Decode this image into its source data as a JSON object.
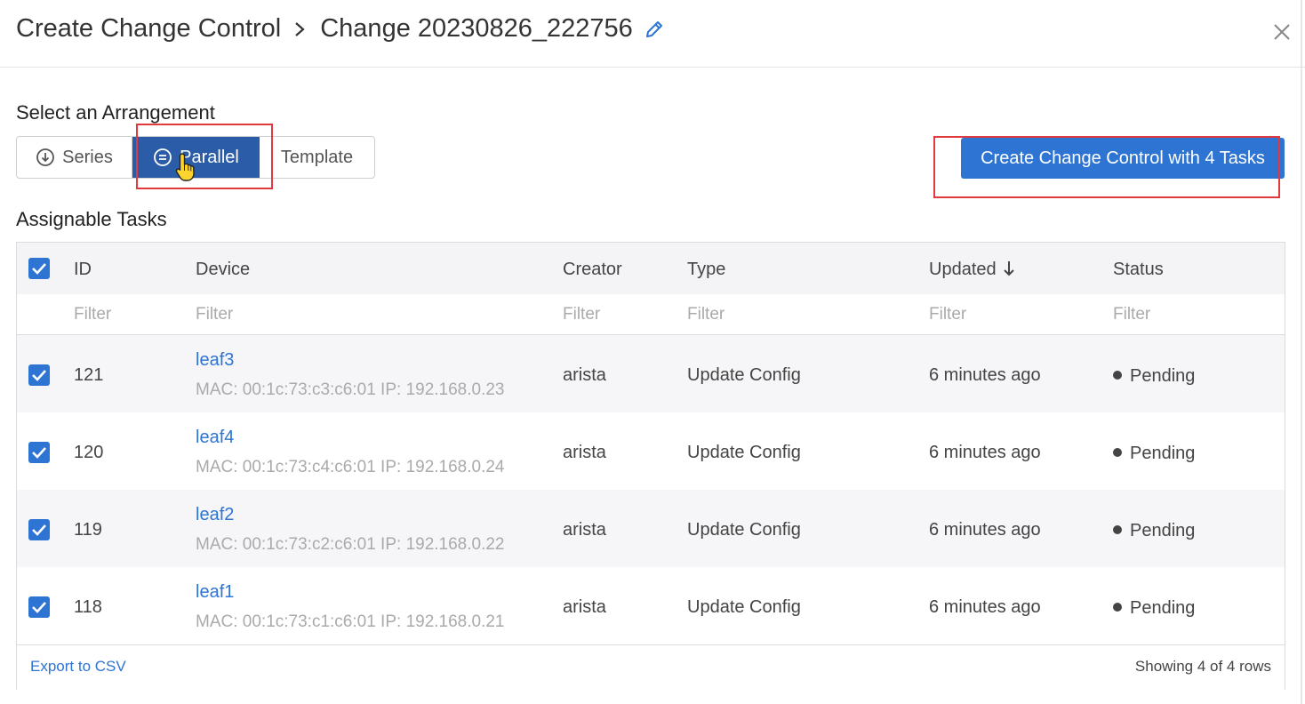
{
  "header": {
    "breadcrumb_parent": "Create Change Control",
    "breadcrumb_current": "Change 20230826_222756",
    "edit_icon": "pencil-icon",
    "close_icon": "close-icon"
  },
  "arrangement": {
    "title": "Select an Arrangement",
    "options": [
      {
        "label": "Series",
        "icon": "arrow-down-circle-icon",
        "selected": false
      },
      {
        "label": "Parallel",
        "icon": "equals-circle-icon",
        "selected": true
      },
      {
        "label": "Template",
        "selected": false
      }
    ]
  },
  "create_button": {
    "label": "Create Change Control with 4 Tasks"
  },
  "tasks": {
    "title": "Assignable Tasks",
    "columns": [
      "ID",
      "Device",
      "Creator",
      "Type",
      "Updated",
      "Status"
    ],
    "sort_column": "Updated",
    "sort_direction": "desc",
    "filter_placeholder": "Filter",
    "rows": [
      {
        "id": "121",
        "device": "leaf3",
        "device_detail": "MAC: 00:1c:73:c3:c6:01 IP: 192.168.0.23",
        "creator": "arista",
        "type": "Update Config",
        "updated": "6 minutes ago",
        "status": "Pending",
        "checked": true
      },
      {
        "id": "120",
        "device": "leaf4",
        "device_detail": "MAC: 00:1c:73:c4:c6:01 IP: 192.168.0.24",
        "creator": "arista",
        "type": "Update Config",
        "updated": "6 minutes ago",
        "status": "Pending",
        "checked": true
      },
      {
        "id": "119",
        "device": "leaf2",
        "device_detail": "MAC: 00:1c:73:c2:c6:01 IP: 192.168.0.22",
        "creator": "arista",
        "type": "Update Config",
        "updated": "6 minutes ago",
        "status": "Pending",
        "checked": true
      },
      {
        "id": "118",
        "device": "leaf1",
        "device_detail": "MAC: 00:1c:73:c1:c6:01 IP: 192.168.0.21",
        "creator": "arista",
        "type": "Update Config",
        "updated": "6 minutes ago",
        "status": "Pending",
        "checked": true
      }
    ],
    "export_label": "Export to CSV",
    "showing_label": "Showing 4 of 4 rows"
  },
  "colors": {
    "accent": "#2e74d3",
    "selected_segment": "#2b5ca8",
    "highlight": "#e0393e"
  }
}
